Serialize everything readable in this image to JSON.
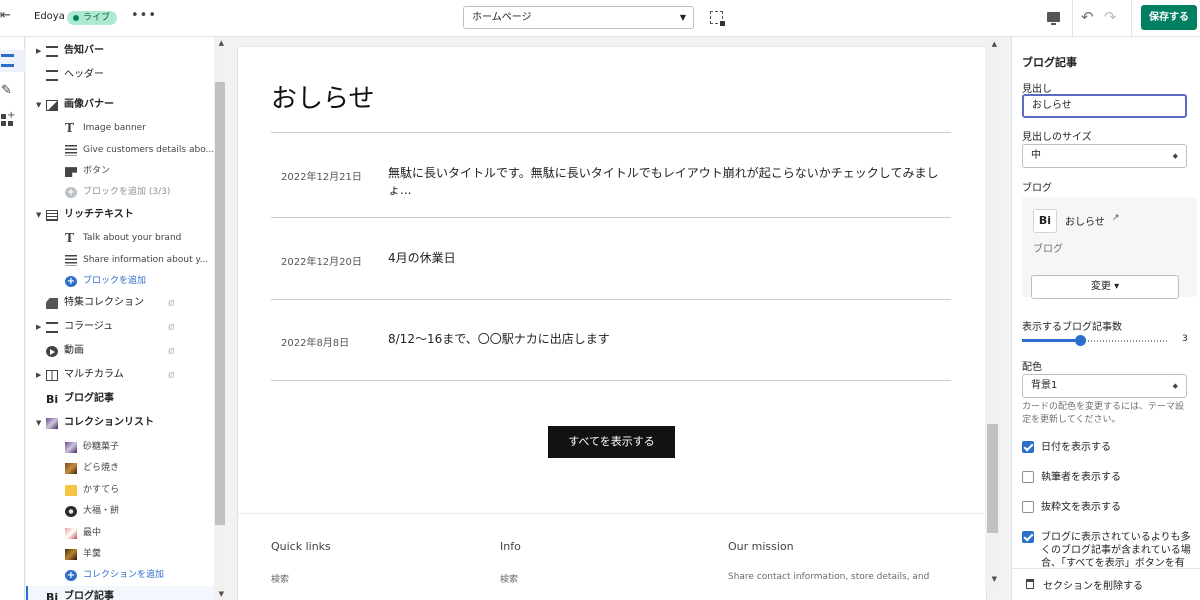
{
  "topbar": {
    "store_name": "Edoya",
    "live_badge": "ライブ",
    "more_label": "•••",
    "page_select": "ホームページ",
    "save_label": "保存する"
  },
  "sidebar": {
    "items": [
      {
        "label": "告知バー"
      },
      {
        "label": "ヘッダー"
      },
      {
        "label": "画像バナー"
      },
      {
        "label": "Image banner"
      },
      {
        "label": "Give customers details abo..."
      },
      {
        "label": "ボタン"
      },
      {
        "label": "ブロックを追加 (3/3)"
      },
      {
        "label": "リッチテキスト"
      },
      {
        "label": "Talk about your brand"
      },
      {
        "label": "Share information about y..."
      },
      {
        "label": "ブロックを追加"
      },
      {
        "label": "特集コレクション"
      },
      {
        "label": "コラージュ"
      },
      {
        "label": "動画"
      },
      {
        "label": "マルチカラム"
      },
      {
        "label": "ブログ記事"
      },
      {
        "label": "コレクションリスト"
      },
      {
        "label": "砂糖菓子"
      },
      {
        "label": "どら焼き"
      },
      {
        "label": "かすてら"
      },
      {
        "label": "大福・餅"
      },
      {
        "label": "最中"
      },
      {
        "label": "羊羹"
      },
      {
        "label": "コレクションを追加"
      },
      {
        "label": "ブログ記事"
      }
    ]
  },
  "preview": {
    "title": "おしらせ",
    "posts": [
      {
        "date": "2022年12月21日",
        "title": "無駄に長いタイトルです。無駄に長いタイトルでもレイアウト崩れが起こらないかチェックしてみましょ..."
      },
      {
        "date": "2022年12月20日",
        "title": "4月の休業日"
      },
      {
        "date": "2022年8月8日",
        "title": "8/12〜16まで、〇〇駅ナカに出店します"
      }
    ],
    "view_all": "すべてを表示する",
    "footer": {
      "quick_links": "Quick links",
      "info": "Info",
      "mission": "Our mission",
      "quick_links_item": "検索",
      "info_item": "検索",
      "mission_text": "Share contact information, store details, and"
    }
  },
  "settings": {
    "heading": "ブログ記事",
    "headline_label": "見出し",
    "headline_value": "おしらせ",
    "size_label": "見出しのサイズ",
    "size_value": "中",
    "blog_label": "ブログ",
    "blog_name": "おしらせ",
    "blog_type": "ブログ",
    "change_label": "変更 ▾",
    "count_label": "表示するブログ記事数",
    "count_value": "3",
    "count_min": 1,
    "count_max": 6,
    "color_label": "配色",
    "color_value": "背景1",
    "color_help": "カードの配色を変更するには、テーマ設定を更新してください。",
    "show_date": "日付を表示する",
    "show_date_checked": true,
    "show_author": "執筆者を表示する",
    "show_author_checked": false,
    "show_excerpt": "抜粋文を表示する",
    "show_excerpt_checked": false,
    "show_view_all": "ブログに表示されているよりも多くのブログ記事が含まれている場合、「すべてを表示」ボタンを有",
    "show_view_all_checked": true,
    "remove_section": "セクションを削除する"
  },
  "colors": {
    "accent": "#2c6ecb",
    "save_button": "#008060",
    "live_badge": "#aee9d1"
  }
}
